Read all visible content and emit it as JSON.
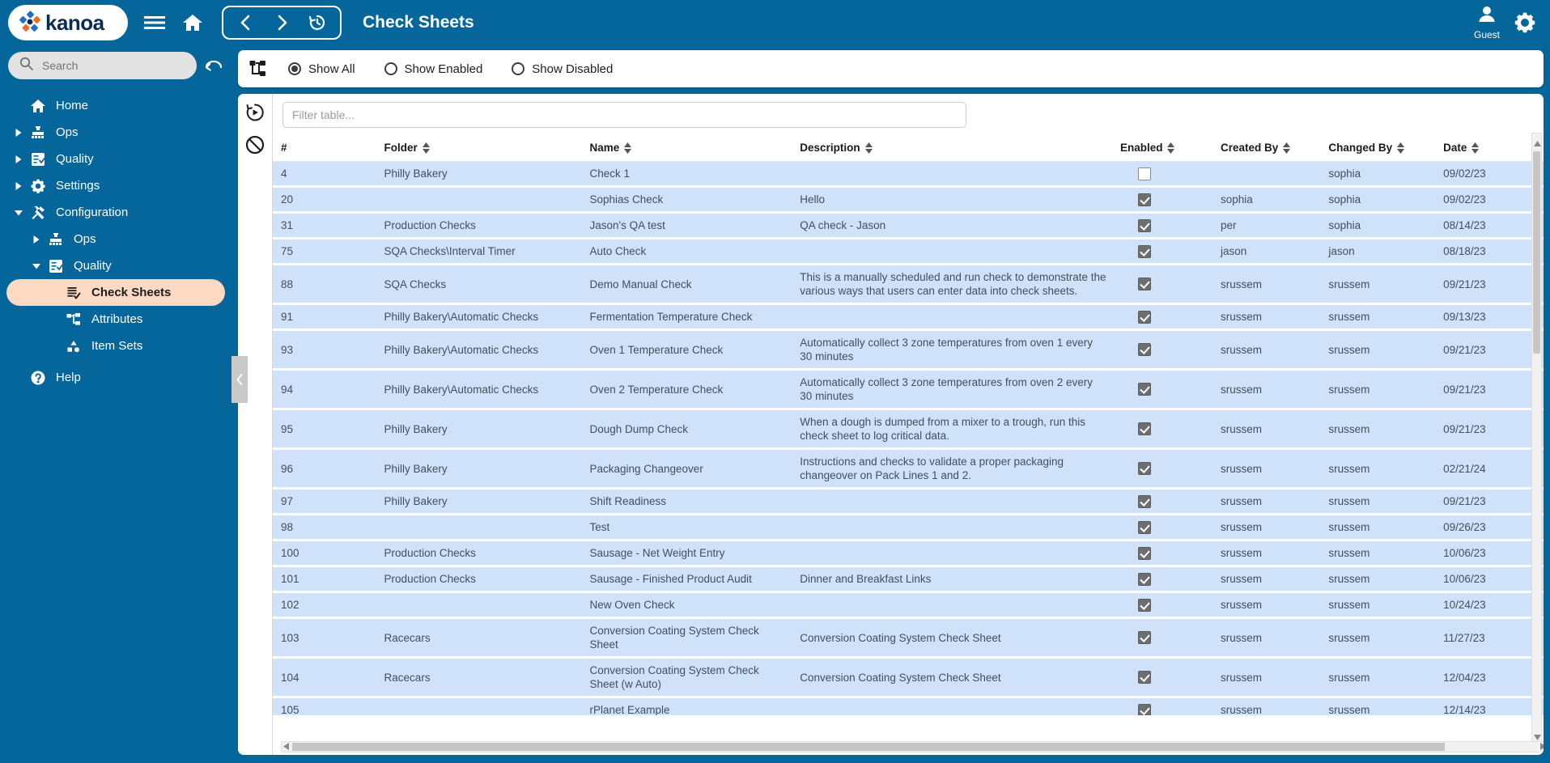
{
  "brand": {
    "name": "kanoa",
    "accent_orange": "#ef6a22",
    "accent_blue": "#1f6fc4",
    "header_blue": "#04669b",
    "active_highlight": "#fbd9c2",
    "row_blue": "#cfe2f9"
  },
  "topbar": {
    "title": "Check Sheets",
    "menu_icon": "hamburger-menu-icon",
    "home_icon": "home-icon",
    "back_icon": "chevron-left-icon",
    "forward_icon": "chevron-right-icon",
    "history_icon": "history-clock-icon",
    "user_name": "Guest",
    "user_icon": "person-icon",
    "settings_icon": "gear-icon"
  },
  "sidebar": {
    "search": {
      "value": "",
      "placeholder": "Search",
      "icon": "search-icon"
    },
    "undo_icon": "undo-arrow-icon",
    "items": [
      {
        "label": "Home",
        "icon": "home-icon",
        "level": 1,
        "caret": "none",
        "active": false
      },
      {
        "label": "Ops",
        "icon": "factory-icon",
        "level": 1,
        "caret": "collapsed",
        "active": false
      },
      {
        "label": "Quality",
        "icon": "clipboard-check-icon",
        "level": 1,
        "caret": "collapsed",
        "active": false
      },
      {
        "label": "Settings",
        "icon": "gear-icon",
        "level": 1,
        "caret": "collapsed",
        "active": false
      },
      {
        "label": "Configuration",
        "icon": "tools-icon",
        "level": 1,
        "caret": "expanded",
        "active": false
      },
      {
        "label": "Ops",
        "icon": "factory-icon",
        "level": 2,
        "caret": "collapsed",
        "active": false
      },
      {
        "label": "Quality",
        "icon": "clipboard-check-icon",
        "level": 2,
        "caret": "expanded",
        "active": false
      },
      {
        "label": "Check Sheets",
        "icon": "checklist-icon",
        "level": 3,
        "caret": "none",
        "active": true
      },
      {
        "label": "Attributes",
        "icon": "attributes-icon",
        "level": 3,
        "caret": "none",
        "active": false
      },
      {
        "label": "Item Sets",
        "icon": "item-sets-icon",
        "level": 3,
        "caret": "none",
        "active": false
      },
      {
        "label": "Help",
        "icon": "help-circle-icon",
        "level": 1,
        "caret": "none",
        "active": false
      }
    ]
  },
  "toolbar": {
    "hierarchy_icon": "hierarchy-icon",
    "radios": [
      {
        "label": "Show All",
        "selected": true
      },
      {
        "label": "Show Enabled",
        "selected": false
      },
      {
        "label": "Show Disabled",
        "selected": false
      }
    ]
  },
  "sidetools": [
    {
      "icon": "run-clock-icon"
    },
    {
      "icon": "disable-circle-slash-icon"
    }
  ],
  "filter": {
    "value": "",
    "placeholder": "Filter table..."
  },
  "table": {
    "columns": [
      {
        "key": "num",
        "label": "#",
        "sortable": false
      },
      {
        "key": "folder",
        "label": "Folder",
        "sortable": true
      },
      {
        "key": "name",
        "label": "Name",
        "sortable": true
      },
      {
        "key": "desc",
        "label": "Description",
        "sortable": true
      },
      {
        "key": "enabled",
        "label": "Enabled",
        "sortable": true
      },
      {
        "key": "created",
        "label": "Created By",
        "sortable": true
      },
      {
        "key": "changed",
        "label": "Changed By",
        "sortable": true
      },
      {
        "key": "date",
        "label": "Date",
        "sortable": true
      }
    ],
    "rows": [
      {
        "num": "4",
        "folder": "Philly Bakery",
        "name": "Check 1",
        "desc": "",
        "enabled": false,
        "created": "",
        "changed": "sophia",
        "date": "09/02/23"
      },
      {
        "num": "20",
        "folder": "",
        "name": "Sophias Check",
        "desc": "Hello",
        "enabled": true,
        "created": "sophia",
        "changed": "sophia",
        "date": "09/02/23"
      },
      {
        "num": "31",
        "folder": "Production Checks",
        "name": "Jason's QA test",
        "desc": "QA check - Jason",
        "enabled": true,
        "created": "per",
        "changed": "sophia",
        "date": "08/14/23"
      },
      {
        "num": "75",
        "folder": "SQA Checks\\Interval Timer",
        "name": "Auto Check",
        "desc": "",
        "enabled": true,
        "created": "jason",
        "changed": "jason",
        "date": "08/18/23"
      },
      {
        "num": "88",
        "folder": "SQA Checks",
        "name": "Demo Manual Check",
        "desc": "This is a manually scheduled and run check to demonstrate the various ways that users can enter data into check sheets.",
        "enabled": true,
        "created": "srussem",
        "changed": "srussem",
        "date": "09/21/23"
      },
      {
        "num": "91",
        "folder": "Philly Bakery\\Automatic Checks",
        "name": "Fermentation Temperature Check",
        "desc": "",
        "enabled": true,
        "created": "srussem",
        "changed": "srussem",
        "date": "09/13/23"
      },
      {
        "num": "93",
        "folder": "Philly Bakery\\Automatic Checks",
        "name": "Oven 1 Temperature Check",
        "desc": "Automatically collect 3 zone temperatures from oven 1 every 30 minutes",
        "enabled": true,
        "created": "srussem",
        "changed": "srussem",
        "date": "09/21/23"
      },
      {
        "num": "94",
        "folder": "Philly Bakery\\Automatic Checks",
        "name": "Oven 2 Temperature Check",
        "desc": "Automatically collect 3 zone temperatures from oven 2 every 30 minutes",
        "enabled": true,
        "created": "srussem",
        "changed": "srussem",
        "date": "09/21/23"
      },
      {
        "num": "95",
        "folder": "Philly Bakery",
        "name": "Dough Dump Check",
        "desc": "When a dough is dumped from a mixer to a trough, run this check sheet to log critical data.",
        "enabled": true,
        "created": "srussem",
        "changed": "srussem",
        "date": "09/21/23"
      },
      {
        "num": "96",
        "folder": "Philly Bakery",
        "name": "Packaging Changeover",
        "desc": "Instructions and checks to validate a proper packaging changeover on Pack Lines 1 and 2.",
        "enabled": true,
        "created": "srussem",
        "changed": "srussem",
        "date": "02/21/24"
      },
      {
        "num": "97",
        "folder": "Philly Bakery",
        "name": "Shift Readiness",
        "desc": "",
        "enabled": true,
        "created": "srussem",
        "changed": "srussem",
        "date": "09/21/23"
      },
      {
        "num": "98",
        "folder": "",
        "name": "Test",
        "desc": "",
        "enabled": true,
        "created": "srussem",
        "changed": "srussem",
        "date": "09/26/23"
      },
      {
        "num": "100",
        "folder": "Production Checks",
        "name": "Sausage - Net Weight Entry",
        "desc": "",
        "enabled": true,
        "created": "srussem",
        "changed": "srussem",
        "date": "10/06/23"
      },
      {
        "num": "101",
        "folder": "Production Checks",
        "name": "Sausage - Finished Product Audit",
        "desc": "Dinner and Breakfast Links",
        "enabled": true,
        "created": "srussem",
        "changed": "srussem",
        "date": "10/06/23"
      },
      {
        "num": "102",
        "folder": "",
        "name": "New Oven Check",
        "desc": "",
        "enabled": true,
        "created": "srussem",
        "changed": "srussem",
        "date": "10/24/23"
      },
      {
        "num": "103",
        "folder": "Racecars",
        "name": "Conversion Coating System Check Sheet",
        "desc": "Conversion Coating System Check Sheet",
        "enabled": true,
        "created": "srussem",
        "changed": "srussem",
        "date": "11/27/23"
      },
      {
        "num": "104",
        "folder": "Racecars",
        "name": "Conversion Coating System Check Sheet (w Auto)",
        "desc": "Conversion Coating System Check Sheet",
        "enabled": true,
        "created": "srussem",
        "changed": "srussem",
        "date": "12/04/23"
      },
      {
        "num": "105",
        "folder": "",
        "name": "rPlanet Example",
        "desc": "",
        "enabled": true,
        "created": "srussem",
        "changed": "srussem",
        "date": "12/14/23"
      }
    ]
  }
}
